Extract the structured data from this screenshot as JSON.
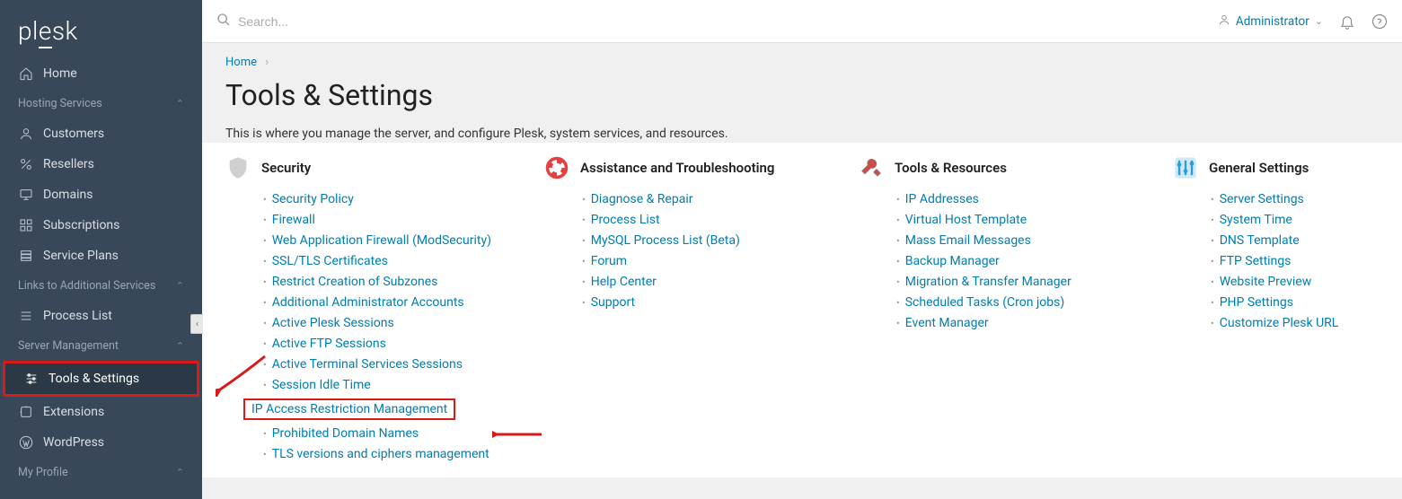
{
  "logo": "plesk",
  "topbar": {
    "search_placeholder": "Search...",
    "user": "Administrator"
  },
  "sidebar": {
    "home": "Home",
    "group_hosting": "Hosting Services",
    "customers": "Customers",
    "resellers": "Resellers",
    "domains": "Domains",
    "subscriptions": "Subscriptions",
    "service_plans": "Service Plans",
    "group_links": "Links to Additional Services",
    "process_list": "Process List",
    "group_server": "Server Management",
    "tools_settings": "Tools & Settings",
    "extensions": "Extensions",
    "wordpress": "WordPress",
    "group_profile": "My Profile"
  },
  "breadcrumb": {
    "item0": "Home"
  },
  "page": {
    "title": "Tools & Settings",
    "desc": "This is where you manage the server, and configure Plesk, system services, and resources."
  },
  "sections": {
    "security": {
      "title": "Security",
      "items": [
        "Security Policy",
        "Firewall",
        "Web Application Firewall (ModSecurity)",
        "SSL/TLS Certificates",
        "Restrict Creation of Subzones",
        "Additional Administrator Accounts",
        "Active Plesk Sessions",
        "Active FTP Sessions",
        "Active Terminal Services Sessions",
        "Session Idle Time",
        "IP Access Restriction Management",
        "Prohibited Domain Names",
        "TLS versions and ciphers management"
      ]
    },
    "assist": {
      "title": "Assistance and Troubleshooting",
      "items": [
        "Diagnose & Repair",
        "Process List",
        "MySQL Process List (Beta)",
        "Forum",
        "Help Center",
        "Support"
      ]
    },
    "tools": {
      "title": "Tools & Resources",
      "items": [
        "IP Addresses",
        "Virtual Host Template",
        "Mass Email Messages",
        "Backup Manager",
        "Migration & Transfer Manager",
        "Scheduled Tasks (Cron jobs)",
        "Event Manager"
      ]
    },
    "general": {
      "title": "General Settings",
      "items": [
        "Server Settings",
        "System Time",
        "DNS Template",
        "FTP Settings",
        "Website Preview",
        "PHP Settings",
        "Customize Plesk URL"
      ]
    }
  }
}
